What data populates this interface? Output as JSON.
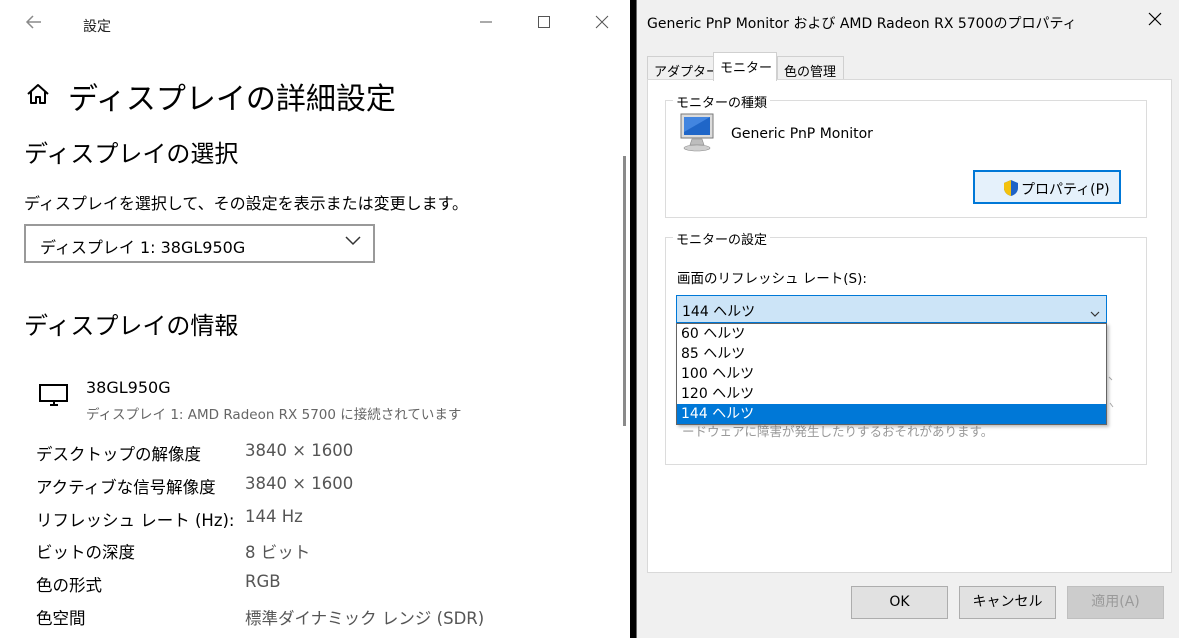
{
  "settings": {
    "window_title": "設定",
    "page_title": "ディスプレイの詳細設定",
    "select_heading": "ディスプレイの選択",
    "select_desc": "ディスプレイを選択して、その設定を表示または変更します。",
    "display_combo_value": "ディスプレイ 1: 38GL950G",
    "info_heading": "ディスプレイの情報",
    "monitor_name": "38GL950G",
    "monitor_sub": "ディスプレイ 1: AMD Radeon RX 5700 に接続されています",
    "info_rows": [
      {
        "k": "デスクトップの解像度",
        "v": "3840 × 1600"
      },
      {
        "k": "アクティブな信号解像度",
        "v": "3840 × 1600"
      },
      {
        "k": "リフレッシュ レート (Hz):",
        "v": "144 Hz"
      },
      {
        "k": "ビットの深度",
        "v": "8 ビット"
      },
      {
        "k": "色の形式",
        "v": "RGB"
      },
      {
        "k": "色空間",
        "v": "標準ダイナミック レンジ (SDR)"
      }
    ]
  },
  "props": {
    "title": "Generic PnP Monitor および AMD Radeon RX 5700のプロパティ",
    "tabs": [
      "アダプター",
      "モニター",
      "色の管理"
    ],
    "monitor_type_group": "モニターの種類",
    "monitor_type_name": "Generic PnP Monitor",
    "properties_button": "プロパティ(P)",
    "monitor_settings_group": "モニターの設定",
    "refresh_label": "画面のリフレッシュ レート(S):",
    "refresh_value": "144 ヘルツ",
    "refresh_options": [
      "60 ヘルツ",
      "85 ヘルツ",
      "100 ヘルツ",
      "120 ヘルツ",
      "144 ヘルツ"
    ],
    "refresh_selected_index": 4,
    "obscured_text": "ードウェアに障害が発生したりするおそれがあります。",
    "ok_button": "OK",
    "cancel_button": "キャンセル",
    "apply_button": "適用(A)"
  },
  "colors": {
    "accent": "#0078d7",
    "dropdown_bg": "#cce4f7",
    "dialog_bg": "#f0f0f0"
  }
}
